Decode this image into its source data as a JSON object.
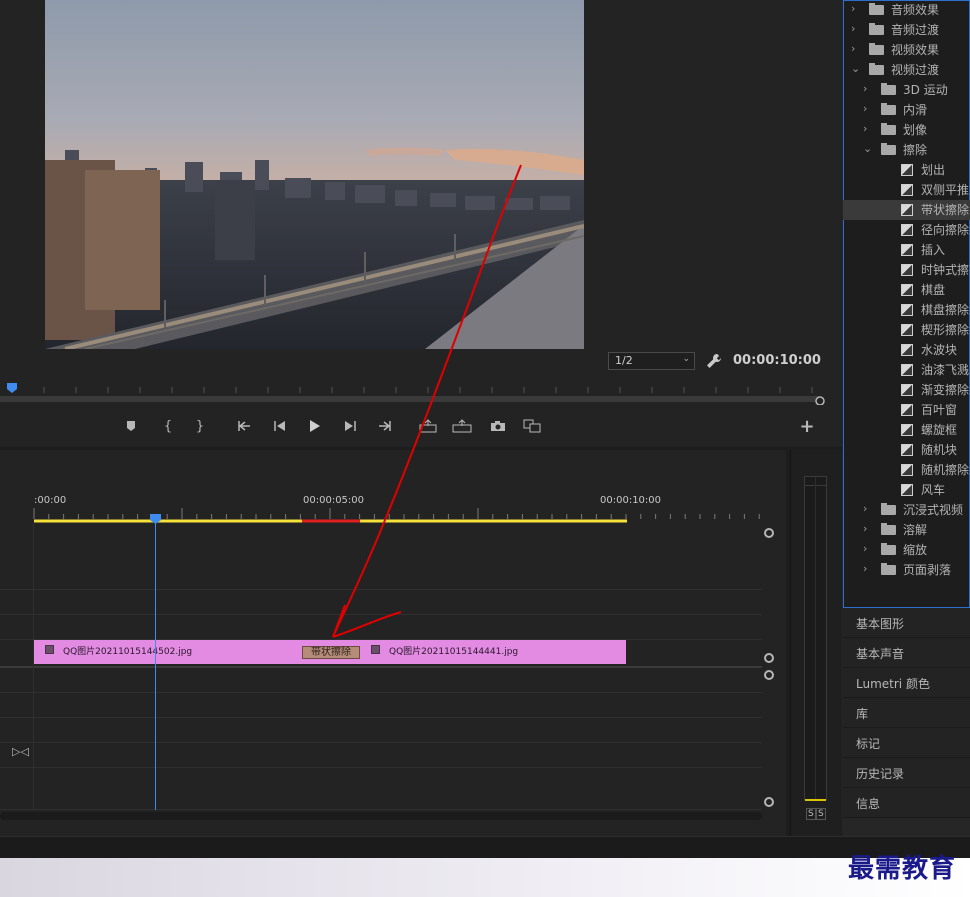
{
  "program_monitor": {
    "resolution": "1/2",
    "timecode": "00:00:10:00"
  },
  "transport_icons": [
    "marker-icon",
    "in-point-icon",
    "out-point-icon",
    "go-to-in-icon",
    "step-back-icon",
    "play-icon",
    "step-forward-icon",
    "go-to-out-icon",
    "lift-icon",
    "extract-icon",
    "camera-icon",
    "compare-icon"
  ],
  "sequence": {
    "ruler_labels": [
      ":00:00",
      "00:00:05:00",
      "00:00:10:00"
    ],
    "clips": [
      {
        "label": "QQ图片20211015144502.jpg"
      },
      {
        "label": "QQ图片20211015144441.jpg"
      }
    ],
    "transition_label": "带状擦除"
  },
  "effects_tree": [
    {
      "label": "音频效果",
      "type": "folder",
      "level": 0,
      "expanded": false
    },
    {
      "label": "音频过渡",
      "type": "folder",
      "level": 0,
      "expanded": false
    },
    {
      "label": "视频效果",
      "type": "folder",
      "level": 0,
      "expanded": false
    },
    {
      "label": "视频过渡",
      "type": "folder",
      "level": 0,
      "expanded": true
    },
    {
      "label": "3D 运动",
      "type": "folder",
      "level": 1,
      "expanded": false
    },
    {
      "label": "内滑",
      "type": "folder",
      "level": 1,
      "expanded": false
    },
    {
      "label": "划像",
      "type": "folder",
      "level": 1,
      "expanded": false
    },
    {
      "label": "擦除",
      "type": "folder",
      "level": 1,
      "expanded": true
    },
    {
      "label": "划出",
      "type": "item",
      "level": 2
    },
    {
      "label": "双侧平推门",
      "type": "item",
      "level": 2
    },
    {
      "label": "带状擦除",
      "type": "item",
      "level": 2,
      "selected": true
    },
    {
      "label": "径向擦除",
      "type": "item",
      "level": 2
    },
    {
      "label": "插入",
      "type": "item",
      "level": 2
    },
    {
      "label": "时钟式擦除",
      "type": "item",
      "level": 2
    },
    {
      "label": "棋盘",
      "type": "item",
      "level": 2
    },
    {
      "label": "棋盘擦除",
      "type": "item",
      "level": 2
    },
    {
      "label": "楔形擦除",
      "type": "item",
      "level": 2
    },
    {
      "label": "水波块",
      "type": "item",
      "level": 2
    },
    {
      "label": "油漆飞溅",
      "type": "item",
      "level": 2
    },
    {
      "label": "渐变擦除",
      "type": "item",
      "level": 2
    },
    {
      "label": "百叶窗",
      "type": "item",
      "level": 2
    },
    {
      "label": "螺旋框",
      "type": "item",
      "level": 2
    },
    {
      "label": "随机块",
      "type": "item",
      "level": 2
    },
    {
      "label": "随机擦除",
      "type": "item",
      "level": 2
    },
    {
      "label": "风车",
      "type": "item",
      "level": 2
    },
    {
      "label": "沉浸式视频",
      "type": "folder",
      "level": 1,
      "expanded": false
    },
    {
      "label": "溶解",
      "type": "folder",
      "level": 1,
      "expanded": false
    },
    {
      "label": "缩放",
      "type": "folder",
      "level": 1,
      "expanded": false
    },
    {
      "label": "页面剥落",
      "type": "folder",
      "level": 1,
      "expanded": false
    }
  ],
  "panels": [
    "基本图形",
    "基本声音",
    "Lumetri 颜色",
    "库",
    "标记",
    "历史记录",
    "信息"
  ],
  "meter": {
    "labels": [
      "S",
      "S"
    ]
  },
  "watermark": "最需教育",
  "colors": {
    "accent": "#2d6fcf",
    "clip": "#e38ae3",
    "transition": "#b48c78",
    "playhead": "#3f8cf0",
    "work_area": "#f5e13a",
    "annotation": "#e00000"
  }
}
